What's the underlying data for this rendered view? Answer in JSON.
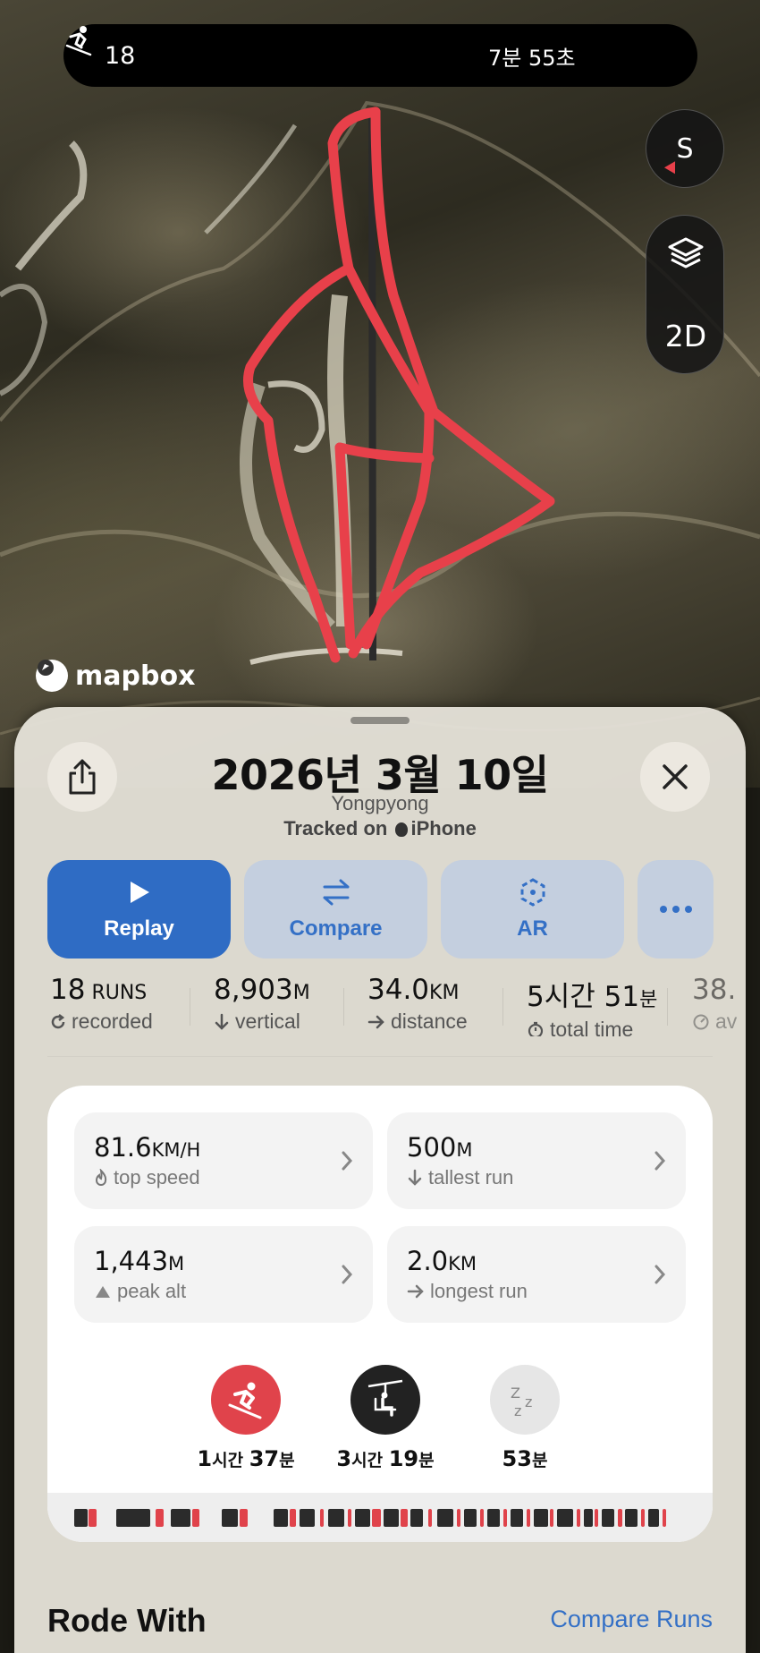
{
  "top_bar": {
    "run_count": "18",
    "elapsed": "7분 55초"
  },
  "map": {
    "compass_label": "S",
    "view_mode": "2D",
    "attribution": "mapbox",
    "track_color": "#e8404a"
  },
  "sheet": {
    "title": "2026년 3월 10일",
    "resort": "Yongpyong",
    "tracked_prefix": "Tracked on",
    "tracked_device": "iPhone"
  },
  "actions": [
    {
      "label": "Replay",
      "icon": "play-icon"
    },
    {
      "label": "Compare",
      "icon": "compare-arrows-icon"
    },
    {
      "label": "AR",
      "icon": "ar-icon"
    },
    {
      "label": "",
      "icon": "more-icon"
    }
  ],
  "stats": [
    {
      "value": "18",
      "unit": " RUNS",
      "label": "recorded",
      "icon": "refresh-icon"
    },
    {
      "value": "8,903",
      "unit": "M",
      "label": "vertical",
      "icon": "arrow-down-icon"
    },
    {
      "value": "34.0",
      "unit": "KM",
      "label": "distance",
      "icon": "arrow-right-icon"
    },
    {
      "value": "5시간 51",
      "unit": "분",
      "label": "total time",
      "icon": "timer-icon"
    },
    {
      "value": "38.",
      "unit": "",
      "label": "av",
      "icon": "gauge-icon"
    }
  ],
  "highlights": [
    {
      "value": "81.6",
      "unit": "KM/H",
      "label": "top speed",
      "icon": "flame-icon"
    },
    {
      "value": "500",
      "unit": "M",
      "label": "tallest run",
      "icon": "arrow-down-icon"
    },
    {
      "value": "1,443",
      "unit": "M",
      "label": "peak alt",
      "icon": "mountain-icon"
    },
    {
      "value": "2.0",
      "unit": "KM",
      "label": "longest run",
      "icon": "arrow-right-icon"
    }
  ],
  "activity": {
    "ski": {
      "hours": "1",
      "h_unit": "시간 ",
      "mins": "37",
      "m_unit": "분",
      "color": "#e0434b"
    },
    "lift": {
      "hours": "3",
      "h_unit": "시간 ",
      "mins": "19",
      "m_unit": "분",
      "color": "#222222"
    },
    "rest": {
      "mins": "53",
      "m_unit": "분",
      "icon_text": "zzz"
    }
  },
  "timeline": {
    "ski_color": "#e0434b",
    "lift_color": "#2b2b2b"
  },
  "footer": {
    "rode_with": "Rode With",
    "compare_runs": "Compare Runs"
  }
}
